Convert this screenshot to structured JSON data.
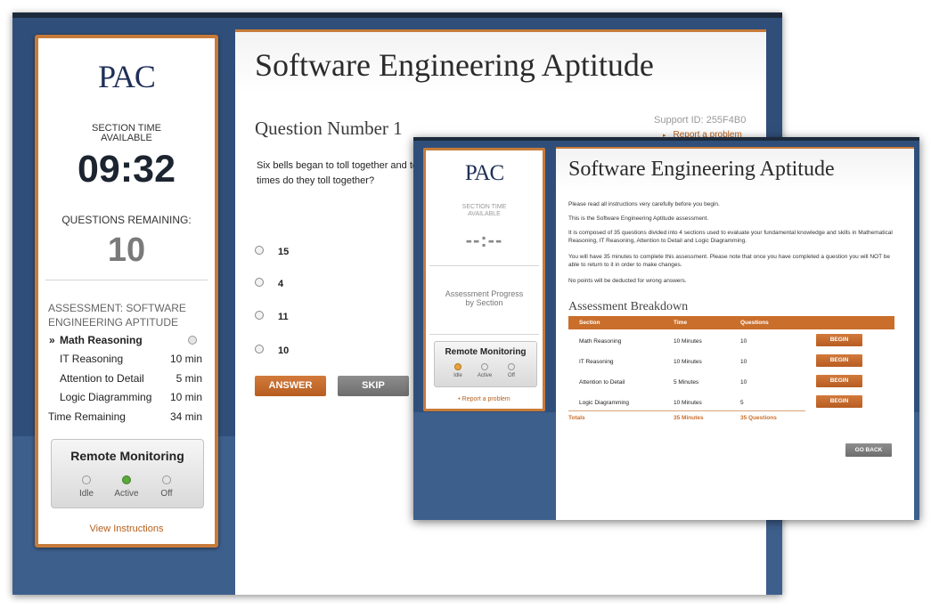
{
  "main": {
    "logo": "PAC",
    "section_time_label": "SECTION TIME AVAILABLE",
    "timer": "09:32",
    "questions_remaining_label": "QUESTIONS REMAINING:",
    "questions_remaining": "10",
    "assessment_label": "ASSESSMENT: SOFTWARE ENGINEERING APTITUDE",
    "sections": [
      {
        "marker": "»",
        "name": "Math Reasoning",
        "time": ""
      },
      {
        "marker": "",
        "name": "IT Reasoning",
        "time": "10 min"
      },
      {
        "marker": "",
        "name": "Attention to Detail",
        "time": "5 min"
      },
      {
        "marker": "",
        "name": "Logic Diagramming",
        "time": "10 min"
      }
    ],
    "time_remaining_label": "Time Remaining",
    "time_remaining": "34 min",
    "remote_monitoring": {
      "title": "Remote Monitoring",
      "states": [
        "Idle",
        "Active",
        "Off"
      ],
      "active_state": "Active"
    },
    "view_instructions": "View Instructions",
    "page_title": "Software Engineering Aptitude",
    "question_title": "Question Number 1",
    "support_id": "Support ID: 255F4B0",
    "report_problem": "Report a problem",
    "question_text": "Six bells began to toll together and to times do they toll together?",
    "options": [
      "15",
      "4",
      "11",
      "10"
    ],
    "answer_button": "ANSWER",
    "skip_button": "SKIP"
  },
  "overlay": {
    "logo": "PAC",
    "section_time_label": "SECTION TIME AVAILABLE",
    "timer": "--:--",
    "progress_label": "Assessment Progress by Section",
    "remote_monitoring": {
      "title": "Remote Monitoring",
      "states": [
        "Idle",
        "Active",
        "Off"
      ],
      "active_state": "Idle"
    },
    "report_problem": "Report a problem",
    "page_title": "Software Engineering Aptitude",
    "paragraphs": [
      "Please read all instructions very carefully before you begin.",
      "This is the Software Engineering Aptitude assessment.",
      "It is composed of 35 questions divided into 4 sections used to evaluate your fundamental knowledge and skills in Mathematical Reasoning, IT Reasoning, Attention to Detail and Logic Diagramming.",
      "You will have 35 minutes to complete this assessment. Please note that once you have completed a question you will NOT be able to return to it in order to make changes.",
      "No points will be deducted for wrong answers."
    ],
    "breakdown_title": "Assessment Breakdown",
    "table": {
      "headers": [
        "Section",
        "Time",
        "Questions"
      ],
      "rows": [
        {
          "section": "Math Reasoning",
          "time": "10 Minutes",
          "questions": "10",
          "action": "BEGIN"
        },
        {
          "section": "IT Reasoning",
          "time": "10 Minutes",
          "questions": "10",
          "action": "BEGIN"
        },
        {
          "section": "Attention to Detail",
          "time": "5 Minutes",
          "questions": "10",
          "action": "BEGIN"
        },
        {
          "section": "Logic Diagramming",
          "time": "10 Minutes",
          "questions": "5",
          "action": "BEGIN"
        }
      ],
      "totals": {
        "label": "Totals",
        "time": "35 Minutes",
        "questions": "35 Questions"
      }
    },
    "go_back_button": "GO BACK"
  },
  "colors": {
    "accent_orange": "#c77b3a",
    "navy_background": "#2f4f7a",
    "logo_navy": "#1f2f57",
    "active_green": "#59a83a",
    "idle_amber": "#e9a23a"
  }
}
